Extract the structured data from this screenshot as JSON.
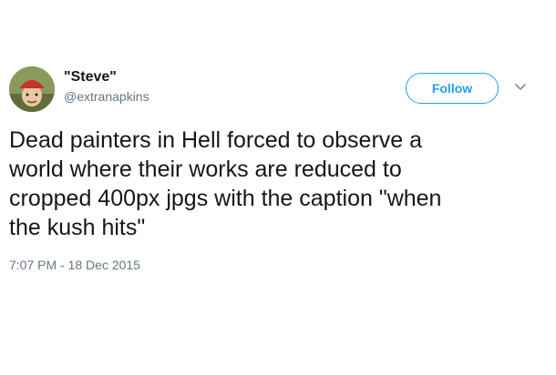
{
  "tweet": {
    "display_name": "\"Steve\"",
    "handle": "@extranapkins",
    "follow_label": "Follow",
    "text": "Dead painters in Hell forced to observe a\nworld where their works are reduced to\ncropped 400px jpgs with the caption \"when\nthe kush hits\"",
    "timestamp": "7:07 PM - 18 Dec 2015"
  },
  "icons": {
    "menu": "chevron-down-icon",
    "avatar": "avatar-image"
  },
  "colors": {
    "accent": "#1da1f2",
    "secondary_text": "#657786",
    "primary_text": "#14171a"
  }
}
